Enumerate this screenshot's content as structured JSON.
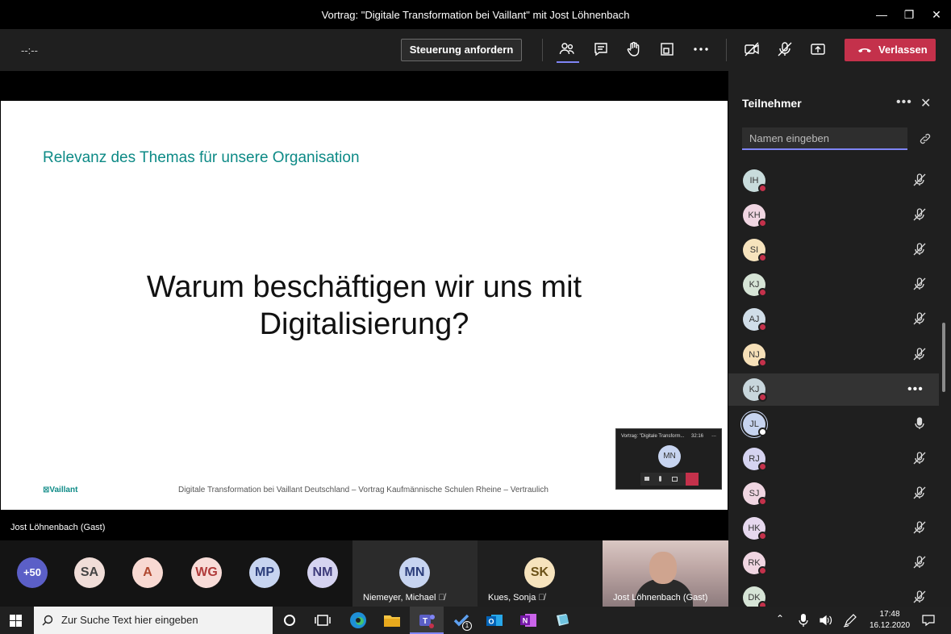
{
  "window": {
    "title": "Vortrag: \"Digitale Transformation bei Vaillant\" mit Jost Löhnenbach",
    "minimize": "—",
    "restore": "❐",
    "close": "✕"
  },
  "toolbar": {
    "timer": "--:--",
    "request_control_label": "Steuerung anfordern",
    "leave_label": "Verlassen",
    "icons": [
      "participants-icon",
      "chat-icon",
      "raise-hand-icon",
      "rooms-icon",
      "more-icon",
      "camera-off-icon",
      "mic-muted-icon",
      "share-icon"
    ],
    "colors": {
      "leave": "#c4314b",
      "accent": "#7f85f5"
    }
  },
  "slide": {
    "heading": "Relevanz des Themas für unsere Organisation",
    "main_line1": "Warum beschäftigen wir uns mit",
    "main_line2": "Digitalisierung?",
    "logo": "⊠Vaillant",
    "footer": "Digitale Transformation bei Vaillant Deutschland – Vortrag Kaufmännische Schulen Rheine – Vertraulich"
  },
  "mini_window": {
    "title": "Vortrag: \"Digitale Transform...",
    "time": "32:16",
    "more": "...",
    "avatar": "MN"
  },
  "presenter_label": "Jost Löhnenbach (Gast)",
  "gallery": {
    "overflow": "+50",
    "avatars": [
      {
        "initials": "SA",
        "bg": "#f0ddd8",
        "fg": "#444"
      },
      {
        "initials": "A",
        "bg": "#f8d9d2",
        "fg": "#b0482f"
      },
      {
        "initials": "WG",
        "bg": "#f8dcd8",
        "fg": "#b03a3a"
      },
      {
        "initials": "MP",
        "bg": "#c7d4f0",
        "fg": "#2b3d7a"
      },
      {
        "initials": "NM",
        "bg": "#d5d3f0",
        "fg": "#3d3a7a"
      }
    ],
    "tiles": [
      {
        "initials": "MN",
        "name": "Niemeyer, Michael",
        "bg": "#c7d4f0",
        "fg": "#2b3d7a"
      },
      {
        "initials": "SK",
        "name": "Kues, Sonja",
        "bg": "#f6e3bd",
        "fg": "#6b5218"
      }
    ],
    "video_name": "Jost Löhnenbach (Gast)"
  },
  "panel": {
    "title": "Teilnehmer",
    "more": "•••",
    "close": "✕",
    "search_placeholder": "Namen eingeben",
    "participants": [
      {
        "initials": "IH",
        "bg": "#c8dcdc",
        "status": "away",
        "mic": "muted"
      },
      {
        "initials": "KH",
        "bg": "#f0d6e2",
        "status": "away",
        "mic": "muted"
      },
      {
        "initials": "SI",
        "bg": "#f6e3bd",
        "status": "away",
        "mic": "muted"
      },
      {
        "initials": "KJ",
        "bg": "#d6e4d6",
        "status": "away",
        "mic": "muted"
      },
      {
        "initials": "AJ",
        "bg": "#d0dde8",
        "status": "away",
        "mic": "muted"
      },
      {
        "initials": "NJ",
        "bg": "#f6e0b8",
        "status": "away",
        "mic": "muted"
      },
      {
        "initials": "KJ",
        "bg": "#c8d6dc",
        "status": "away",
        "mic": "more",
        "active": true
      },
      {
        "initials": "JL",
        "bg": "#c7d4f0",
        "status": "presenter",
        "mic": "on"
      },
      {
        "initials": "RJ",
        "bg": "#d5d3f0",
        "status": "away",
        "mic": "muted"
      },
      {
        "initials": "SJ",
        "bg": "#f0d6e2",
        "status": "away",
        "mic": "muted"
      },
      {
        "initials": "HK",
        "bg": "#e6d8ee",
        "status": "away",
        "mic": "muted"
      },
      {
        "initials": "RK",
        "bg": "#f0d6e2",
        "status": "away",
        "mic": "muted"
      },
      {
        "initials": "DK",
        "bg": "#d6e4d6",
        "status": "away",
        "mic": "muted"
      }
    ]
  },
  "taskbar": {
    "search_placeholder": "Zur Suche Text hier eingeben",
    "time": "17:48",
    "date": "16.12.2020",
    "apps": [
      "cortana-icon",
      "task-view-icon",
      "edge-icon",
      "file-explorer-icon",
      "teams-icon",
      "todo-icon",
      "outlook-icon",
      "onenote-icon",
      "app-icon"
    ],
    "todo_badge": "1"
  }
}
